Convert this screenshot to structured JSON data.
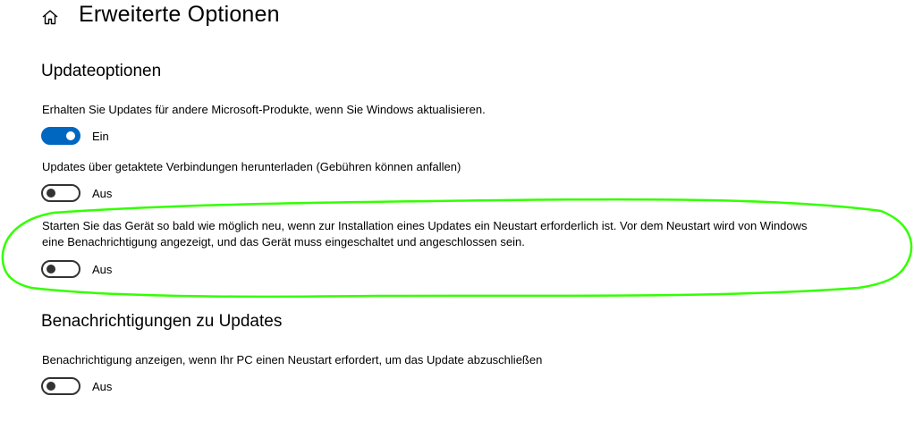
{
  "header": {
    "title": "Erweiterte Optionen",
    "home_icon": "home-icon"
  },
  "sections": [
    {
      "heading": "Updateoptionen",
      "options": [
        {
          "description": "Erhalten Sie Updates für andere Microsoft-Produkte, wenn Sie Windows aktualisieren.",
          "state": "on",
          "state_label": "Ein"
        },
        {
          "description": "Updates über getaktete Verbindungen herunterladen (Gebühren können anfallen)",
          "state": "off",
          "state_label": "Aus"
        },
        {
          "description": "Starten Sie das Gerät so bald wie möglich neu, wenn zur Installation eines Updates ein Neustart erforderlich ist. Vor dem Neustart wird von Windows eine Benachrichtigung angezeigt, und das Gerät muss eingeschaltet und angeschlossen sein.",
          "state": "off",
          "state_label": "Aus"
        }
      ]
    },
    {
      "heading": "Benachrichtigungen zu Updates",
      "options": [
        {
          "description": "Benachrichtigung anzeigen, wenn Ihr PC einen Neustart erfordert, um das Update abzuschließen",
          "state": "off",
          "state_label": "Aus"
        }
      ]
    }
  ],
  "colors": {
    "toggle_on": "#0067c0",
    "toggle_off_border": "#333333",
    "annotation": "#33ff00"
  }
}
